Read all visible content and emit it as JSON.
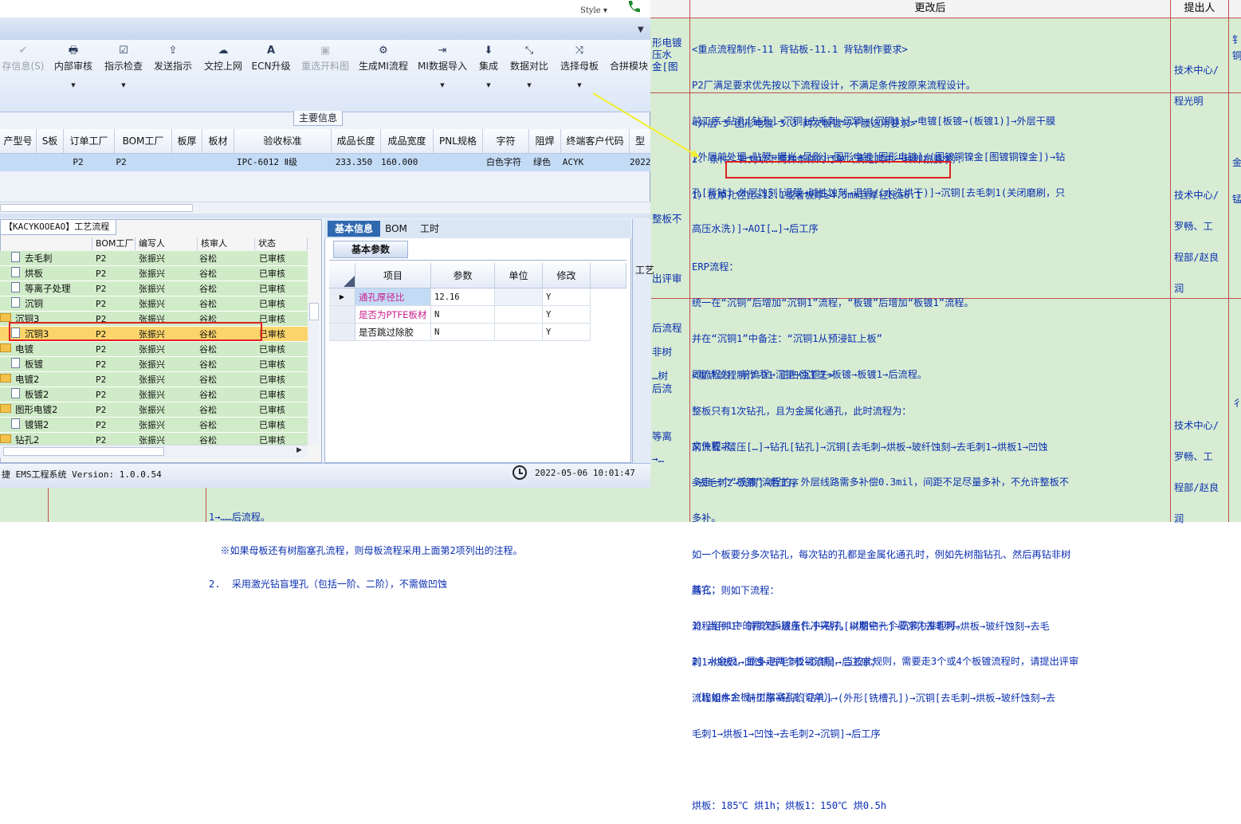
{
  "app": {
    "style_label": "Style ▾",
    "toolbar": [
      {
        "label": "存信息(S)",
        "icon": "check-icon",
        "disabled": true,
        "dropdown": false
      },
      {
        "label": "内部审核",
        "icon": "printer-icon",
        "disabled": false,
        "dropdown": true
      },
      {
        "label": "指示检查",
        "icon": "checkbox-icon",
        "disabled": false,
        "dropdown": true
      },
      {
        "label": "发送指示",
        "icon": "upload-icon",
        "disabled": false,
        "dropdown": false
      },
      {
        "label": "文控上网",
        "icon": "cloud-icon",
        "disabled": false,
        "dropdown": false
      },
      {
        "label": "ECN升级",
        "icon": "letter-a-icon",
        "disabled": false,
        "dropdown": false
      },
      {
        "label": "重选开料图",
        "icon": "image-icon",
        "disabled": true,
        "dropdown": false
      },
      {
        "label": "生成MI流程",
        "icon": "gears-icon",
        "disabled": false,
        "dropdown": false
      },
      {
        "label": "MI数据导入",
        "icon": "import-icon",
        "disabled": false,
        "dropdown": true
      },
      {
        "label": "集成",
        "icon": "download-icon",
        "disabled": false,
        "dropdown": true
      },
      {
        "label": "数据对比",
        "icon": "compare-icon",
        "disabled": false,
        "dropdown": true
      },
      {
        "label": "选择母板",
        "icon": "shuffle-icon",
        "disabled": false,
        "dropdown": true
      },
      {
        "label": "合拼模块",
        "icon": "",
        "disabled": false,
        "dropdown": false
      }
    ],
    "main_info_tab": "主要信息",
    "grid": {
      "headers": [
        "产型号",
        "S板",
        "订单工厂",
        "BOM工厂",
        "板厚",
        "板材",
        "验收标准",
        "成品长度",
        "成品宽度",
        "PNL规格",
        "字符",
        "阻焊",
        "终端客户代码",
        "型"
      ],
      "row": [
        "",
        "",
        "P2",
        "P2",
        "",
        "",
        "IPC-6012 Ⅱ级",
        "233.350",
        "160.000",
        "",
        "白色字符",
        "绿色",
        "ACYK",
        "2022"
      ]
    },
    "tree": {
      "title": "【KACYKOOEAO】工艺流程",
      "headers": [
        "",
        "BOM工厂",
        "编写人",
        "核审人",
        "状态"
      ],
      "rows": [
        {
          "name": "去毛刺",
          "type": "doc",
          "indent": 1,
          "factory": "P2",
          "writer": "张振兴",
          "reviewer": "谷松",
          "status": "已审核"
        },
        {
          "name": "烘板",
          "type": "doc",
          "indent": 1,
          "factory": "P2",
          "writer": "张振兴",
          "reviewer": "谷松",
          "status": "已审核"
        },
        {
          "name": "等离子处理",
          "type": "doc",
          "indent": 1,
          "factory": "P2",
          "writer": "张振兴",
          "reviewer": "谷松",
          "status": "已审核"
        },
        {
          "name": "沉铜",
          "type": "doc",
          "indent": 1,
          "factory": "P2",
          "writer": "张振兴",
          "reviewer": "谷松",
          "status": "已审核"
        },
        {
          "name": "沉铜3",
          "type": "folder",
          "indent": 0,
          "factory": "P2",
          "writer": "张振兴",
          "reviewer": "谷松",
          "status": "已审核"
        },
        {
          "name": "沉铜3",
          "type": "doc",
          "indent": 1,
          "factory": "P2",
          "writer": "张振兴",
          "reviewer": "谷松",
          "status": "已审核",
          "selected": true
        },
        {
          "name": "电镀",
          "type": "folder",
          "indent": 0,
          "factory": "P2",
          "writer": "张振兴",
          "reviewer": "谷松",
          "status": "已审核"
        },
        {
          "name": "板镀",
          "type": "doc",
          "indent": 1,
          "factory": "P2",
          "writer": "张振兴",
          "reviewer": "谷松",
          "status": "已审核"
        },
        {
          "name": "电镀2",
          "type": "folder",
          "indent": 0,
          "factory": "P2",
          "writer": "张振兴",
          "reviewer": "谷松",
          "status": "已审核"
        },
        {
          "name": "板镀2",
          "type": "doc",
          "indent": 1,
          "factory": "P2",
          "writer": "张振兴",
          "reviewer": "谷松",
          "status": "已审核"
        },
        {
          "name": "图形电镀2",
          "type": "folder",
          "indent": 0,
          "factory": "P2",
          "writer": "张振兴",
          "reviewer": "谷松",
          "status": "已审核"
        },
        {
          "name": "镀锡2",
          "type": "doc",
          "indent": 1,
          "factory": "P2",
          "writer": "张振兴",
          "reviewer": "谷松",
          "status": "已审核"
        },
        {
          "name": "钻孔2",
          "type": "folder",
          "indent": 0,
          "factory": "P2",
          "writer": "张振兴",
          "reviewer": "谷松",
          "status": "已审核"
        }
      ]
    },
    "info": {
      "tabs": [
        "基本信息",
        "BOM",
        "工时"
      ],
      "sub_tab": "基本参数",
      "headers": [
        "项目",
        "参数",
        "单位",
        "修改"
      ],
      "rows": [
        {
          "item": "通孔厚径比",
          "value": "12.16",
          "unit": "",
          "edit": "Y",
          "current": true
        },
        {
          "item": "是否为PTFE板材",
          "value": "N",
          "unit": "",
          "edit": "Y"
        },
        {
          "item": "是否跳过除胶",
          "value": "N",
          "unit": "",
          "edit": "Y"
        }
      ],
      "side_label": "工艺"
    },
    "status": {
      "version": "捷 EMS工程系统 Version: 1.0.0.54",
      "datetime": "2022-05-06 10:01:47"
    }
  },
  "document": {
    "header_changed": "更改后",
    "header_proposer": "提出人",
    "left_fragments": [
      "形电镀",
      "压水",
      "金[图",
      "整板不",
      "出评审",
      "后流程",
      "非树",
      "…树",
      "后流",
      "等离",
      "→…"
    ],
    "section1": {
      "lines": [
        "<重点流程制作-11 背钻板-11.1 背钻制作要求>",
        "P2厂满足要求优先按以下流程设计，不满足条件按原来流程设计。",
        "前工序→钻孔[钻孔]→沉铜[去毛刺→沉铜→(沉铜1)]→电镀[板镀→(板镀1)]→外层干膜",
        "[外层前处理→贴膜→曝光→显影]→图形电镀[图形电镀]/(图镀铜镍金[图镀铜镍金])→钻",
        "孔[背钻]→外层蚀刻[退膜→碱性蚀刻→退锡/(水洗烘干)]→沉铜[去毛刺1(关闭磨刷，只",
        "高压水洗)]→AOI[…]→后工序"
      ],
      "owner": [
        "技术中心/",
        "程光明"
      ]
    },
    "section2": {
      "lines": [
        "<外层-3 图形电镀-3.3 两次板镀与干膜选用要求>",
        "2. 条件：针对以下两种条件的订单（满足其中一种即按要求）：",
        "1）板厚孔径比≥12:1或者板厚≥4.5mm且厚径比≥6:1",
        "",
        "ERP流程：",
        "统一在“沉铜”后增加“沉铜1”流程，“板镀”后增加“板镀1”流程。",
        "并在“沉铜1”中备注：“沉铜1从预浸缸上板”",
        "即流程为：前流程→沉铜→沉铜1→板镀→板镀1→后流程。",
        "",
        "文件要求：",
        "多走一个“板镀”流程的，外层线路需多补偿0.3mil，间距不足尽量多补，不允许整板不",
        "多补。",
        "",
        "其它：",
        "1）当与1中的两次板镀条件冲突时，以期中一个要求为准即可。",
        "2）水金板，最多走两个板镀流程，当按此规则，需要走3个或4个板镀流程时，请提出评审",
        "（比如水金板+树脂塞孔的订单）。"
      ],
      "owner": [
        "技术中心/",
        "罗畅、工",
        "程部/赵良",
        "润"
      ]
    },
    "section3": {
      "lines": [
        "<重点流程制作-21 正凹蚀工艺>",
        "整板只有1次钻孔，且为金属化通孔，此时流程为：",
        "前流程→层压[…]→钻孔[钻孔]→沉铜[去毛刺→烘板→玻纤蚀刻→去毛刺1→烘板1→凹蚀",
        "→去毛刺2→沉铜]→后工序",
        "",
        "如一个板要分多次钻孔，每次钻的孔都是金属化通孔时，例如先树脂钻孔、然后再钻非树",
        "脂孔，则如下流程：",
        "流程组件1：前流程→层压[…]→钻孔[树脂钻孔]→沉铜[去毛刺→烘板→玻纤蚀刻→去毛",
        "刺1→烘板1→凹蚀→去毛刺2→沉铜]→后工序；",
        "流程组件2：前工序→钻孔[钻孔]→(外形[铣槽孔])→沉铜[去毛刺→烘板→玻纤蚀刻→去",
        "毛刺1→烘板1→凹蚀→去毛刺2→沉铜]→后工序",
        "",
        "烘板：185℃ 烘1h；烘板1：150℃ 烘0.5h"
      ],
      "owner": [
        "技术中心/",
        "罗畅、工",
        "程部/赵良",
        "润"
      ]
    },
    "bottom_left_lines": [
      "1→……后流程。",
      "  ※如果母板还有树脂塞孔流程，则母板流程采用上面第2项列出的注程。",
      "2.  采用激光钻盲埋孔（包括一阶、二阶），不需做凹蚀"
    ],
    "right_edge": [
      "钅",
      "铜",
      "金",
      "锰",
      "彳"
    ]
  },
  "colors": {
    "doc_bg": "#d7ecd2",
    "doc_text": "#0b2fb0",
    "border_red": "#c0504d",
    "annotation_red": "#e02020",
    "arrow_yellow": "#f3ef2c",
    "row_selected_blue": "#c4dbf6",
    "tree_row_green": "#d0ebc8",
    "tree_selected": "#fbd56b"
  }
}
